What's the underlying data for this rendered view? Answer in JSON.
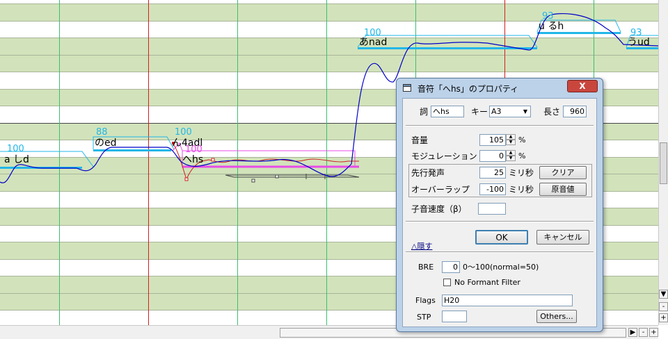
{
  "piano_roll": {
    "notes": [
      {
        "lyric": "a しd",
        "velocity": "100"
      },
      {
        "lyric": "のed",
        "velocity": "88"
      },
      {
        "lyric": "ん4adl",
        "velocity": "100"
      },
      {
        "lyric": "へhs",
        "velocity": "100"
      },
      {
        "lyric": "あnad",
        "velocity": "100"
      },
      {
        "lyric": "u るh",
        "velocity": "93"
      },
      {
        "lyric": "うud",
        "velocity": "93"
      }
    ],
    "colors": {
      "light_row": "#d2e3bb",
      "note_bar": "#22b7e8",
      "pitch_curve": "#0000c8",
      "selected": "#e84be8",
      "red_curve": "#d02020",
      "bar_line": "#d02020",
      "beat_line": "#3cbf6e"
    }
  },
  "scrollbars": {
    "v_up": "▲",
    "v_down": "▼",
    "v_plus": "+",
    "v_minus": "-",
    "h_right": "▶",
    "h_minus": "-",
    "h_plus": "+"
  },
  "dialog": {
    "title": "音符「へhs」のプロパティ",
    "close_label": "X",
    "lyric_label": "詞",
    "lyric_value": "へhs",
    "key_label": "キー",
    "key_value": "A3",
    "length_label": "長さ",
    "length_value": "960",
    "volume_label": "音量",
    "volume_value": "105",
    "volume_unit": "%",
    "modulation_label": "モジュレーション",
    "modulation_value": "0",
    "modulation_unit": "%",
    "preutter_label": "先行発声",
    "preutter_value": "25",
    "preutter_unit": "ミリ秒",
    "clear_button": "クリア",
    "overlap_label": "オーバーラップ",
    "overlap_value": "-100",
    "overlap_unit": "ミリ秒",
    "original_button": "原音値",
    "consonant_label": "子音速度（β）",
    "consonant_value": "",
    "ok_button": "OK",
    "cancel_button": "キャンセル",
    "hide_link": "△隠す",
    "bre_label": "BRE",
    "bre_value": "0",
    "bre_hint": "0〜100(normal=50)",
    "formant_label": "No Formant Filter",
    "flags_label": "Flags",
    "flags_value": "H20",
    "stp_label": "STP",
    "stp_value": "",
    "others_button": "Others..."
  }
}
